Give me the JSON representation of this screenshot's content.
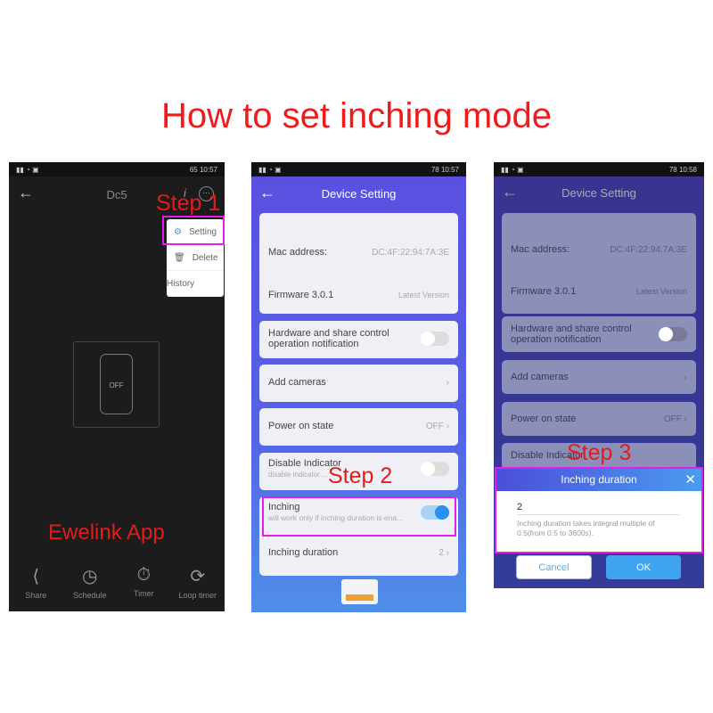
{
  "title": "How to set inching mode",
  "screen1": {
    "status_time": "10:57",
    "battery": "65",
    "device_name": "Dc5",
    "step": "Step 1",
    "menu": [
      "Setting",
      "Delete",
      "History"
    ],
    "switch_state": "OFF",
    "label": "Ewelink App",
    "nav": [
      {
        "icon": "share-icon",
        "label": "Share"
      },
      {
        "icon": "alarm-clock-icon",
        "label": "Schedule"
      },
      {
        "icon": "stopwatch-icon",
        "label": "Timer"
      },
      {
        "icon": "loop-icon",
        "label": "Loop timer"
      }
    ]
  },
  "screen2": {
    "status_time": "10:57",
    "battery": "78",
    "header": "Device Setting",
    "mac_label": "Mac address:",
    "mac_value": "DC:4F:22:94:7A:3E",
    "firmware_label": "Firmware  3.0.1",
    "firmware_status": "Latest Version",
    "hardware_notif": "Hardware and share control operation notification",
    "add_cameras": "Add cameras",
    "power_on_label": "Power on state",
    "power_on_value": "OFF",
    "disable_indicator": "Disable Indicator",
    "disable_indicator_sub": "disable indicator ...",
    "step": "Step 2",
    "inching": "Inching",
    "inching_sub": "will work only if inching duration is ena...",
    "inching_on": true,
    "inching_duration": "Inching duration",
    "inching_duration_value": "2",
    "accent": "#2a8ef2"
  },
  "screen3": {
    "status_time": "10:58",
    "battery": "78",
    "header": "Device Setting",
    "mac_label": "Mac address:",
    "mac_value": "DC:4F:22:94:7A:3E",
    "firmware_label": "Firmware  3.0.1",
    "firmware_status": "Latest Version",
    "hardware_notif": "Hardware and share control operation notification",
    "add_cameras": "Add cameras",
    "power_on_label": "Power on state",
    "power_on_value": "OFF",
    "disable_indicator": "Disable Indicator",
    "step": "Step 3",
    "dialog": {
      "title": "Inching duration",
      "value": "2",
      "hint": "Inching duration takes integral multiple of 0.5(from 0.5 to 3600s).",
      "cancel": "Cancel",
      "ok": "OK"
    }
  }
}
